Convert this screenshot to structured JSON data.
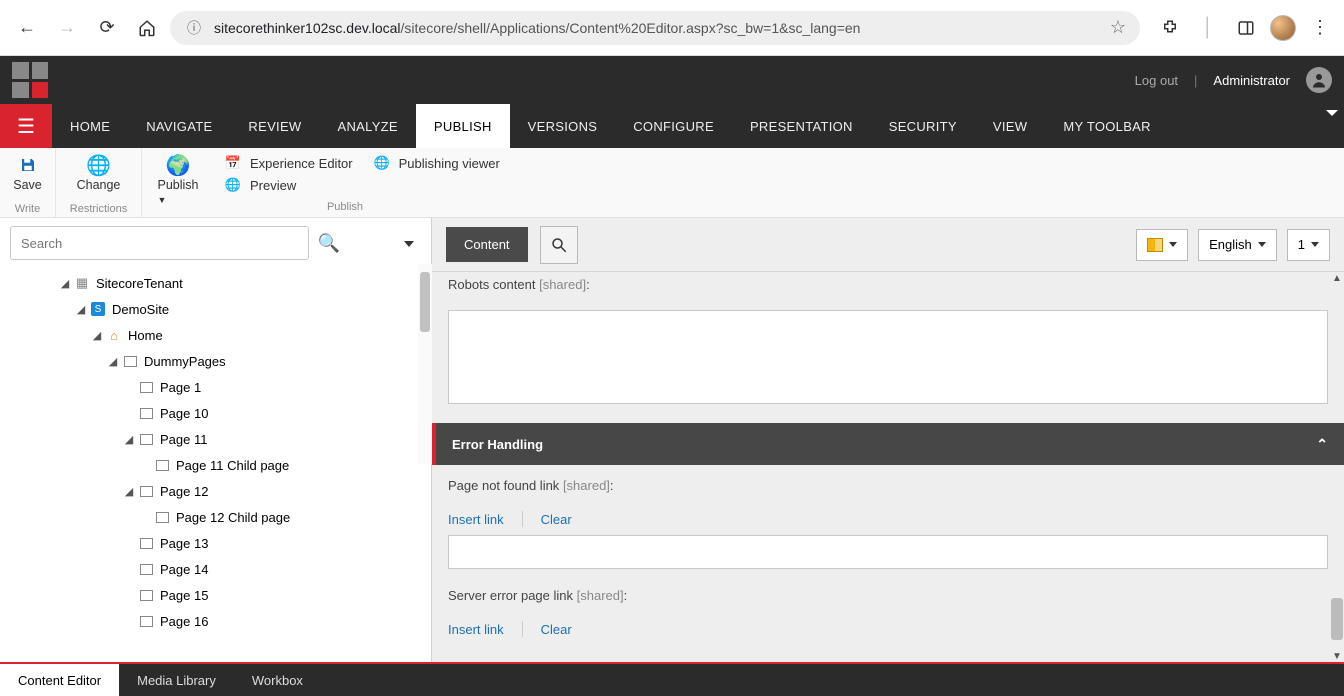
{
  "browser": {
    "url_host": "sitecorethinker102sc.dev.local",
    "url_path": "/sitecore/shell/Applications/Content%20Editor.aspx?sc_bw=1&sc_lang=en"
  },
  "topbar": {
    "logout": "Log out",
    "user": "Administrator"
  },
  "menu": {
    "items": [
      "HOME",
      "NAVIGATE",
      "REVIEW",
      "ANALYZE",
      "PUBLISH",
      "VERSIONS",
      "CONFIGURE",
      "PRESENTATION",
      "SECURITY",
      "VIEW",
      "MY TOOLBAR"
    ],
    "active_index": 4
  },
  "ribbon": {
    "save": "Save",
    "write": "Write",
    "change": "Change",
    "restrictions": "Restrictions",
    "publish": "Publish",
    "experience_editor": "Experience Editor",
    "preview": "Preview",
    "publishing_viewer": "Publishing viewer",
    "publish_group": "Publish"
  },
  "tree": {
    "search_placeholder": "Search",
    "nodes": [
      {
        "label": "SitecoreTenant",
        "depth": 0,
        "expanded": true,
        "icon": "tenant"
      },
      {
        "label": "DemoSite",
        "depth": 1,
        "expanded": true,
        "icon": "site"
      },
      {
        "label": "Home",
        "depth": 2,
        "expanded": true,
        "icon": "home"
      },
      {
        "label": "DummyPages",
        "depth": 3,
        "expanded": true,
        "icon": "folder"
      },
      {
        "label": "Page 1",
        "depth": 4,
        "expanded": null,
        "icon": "folder"
      },
      {
        "label": "Page 10",
        "depth": 4,
        "expanded": null,
        "icon": "folder"
      },
      {
        "label": "Page 11",
        "depth": 4,
        "expanded": true,
        "icon": "folder"
      },
      {
        "label": "Page 11 Child page",
        "depth": 5,
        "expanded": null,
        "icon": "folder"
      },
      {
        "label": "Page 12",
        "depth": 4,
        "expanded": true,
        "icon": "folder"
      },
      {
        "label": "Page 12 Child page",
        "depth": 5,
        "expanded": null,
        "icon": "folder"
      },
      {
        "label": "Page 13",
        "depth": 4,
        "expanded": null,
        "icon": "folder"
      },
      {
        "label": "Page 14",
        "depth": 4,
        "expanded": null,
        "icon": "folder"
      },
      {
        "label": "Page 15",
        "depth": 4,
        "expanded": null,
        "icon": "folder"
      },
      {
        "label": "Page 16",
        "depth": 4,
        "expanded": null,
        "icon": "folder"
      }
    ]
  },
  "content_header": {
    "content_btn": "Content",
    "language": "English",
    "version": "1"
  },
  "form": {
    "robots_label": "Robots content",
    "shared": "[shared]",
    "error_section": "Error Handling",
    "pnf_label": "Page not found link",
    "sep_label": "Server error page link",
    "insert_link": "Insert link",
    "clear": "Clear"
  },
  "bottom_tabs": {
    "items": [
      "Content Editor",
      "Media Library",
      "Workbox"
    ],
    "active_index": 0
  }
}
